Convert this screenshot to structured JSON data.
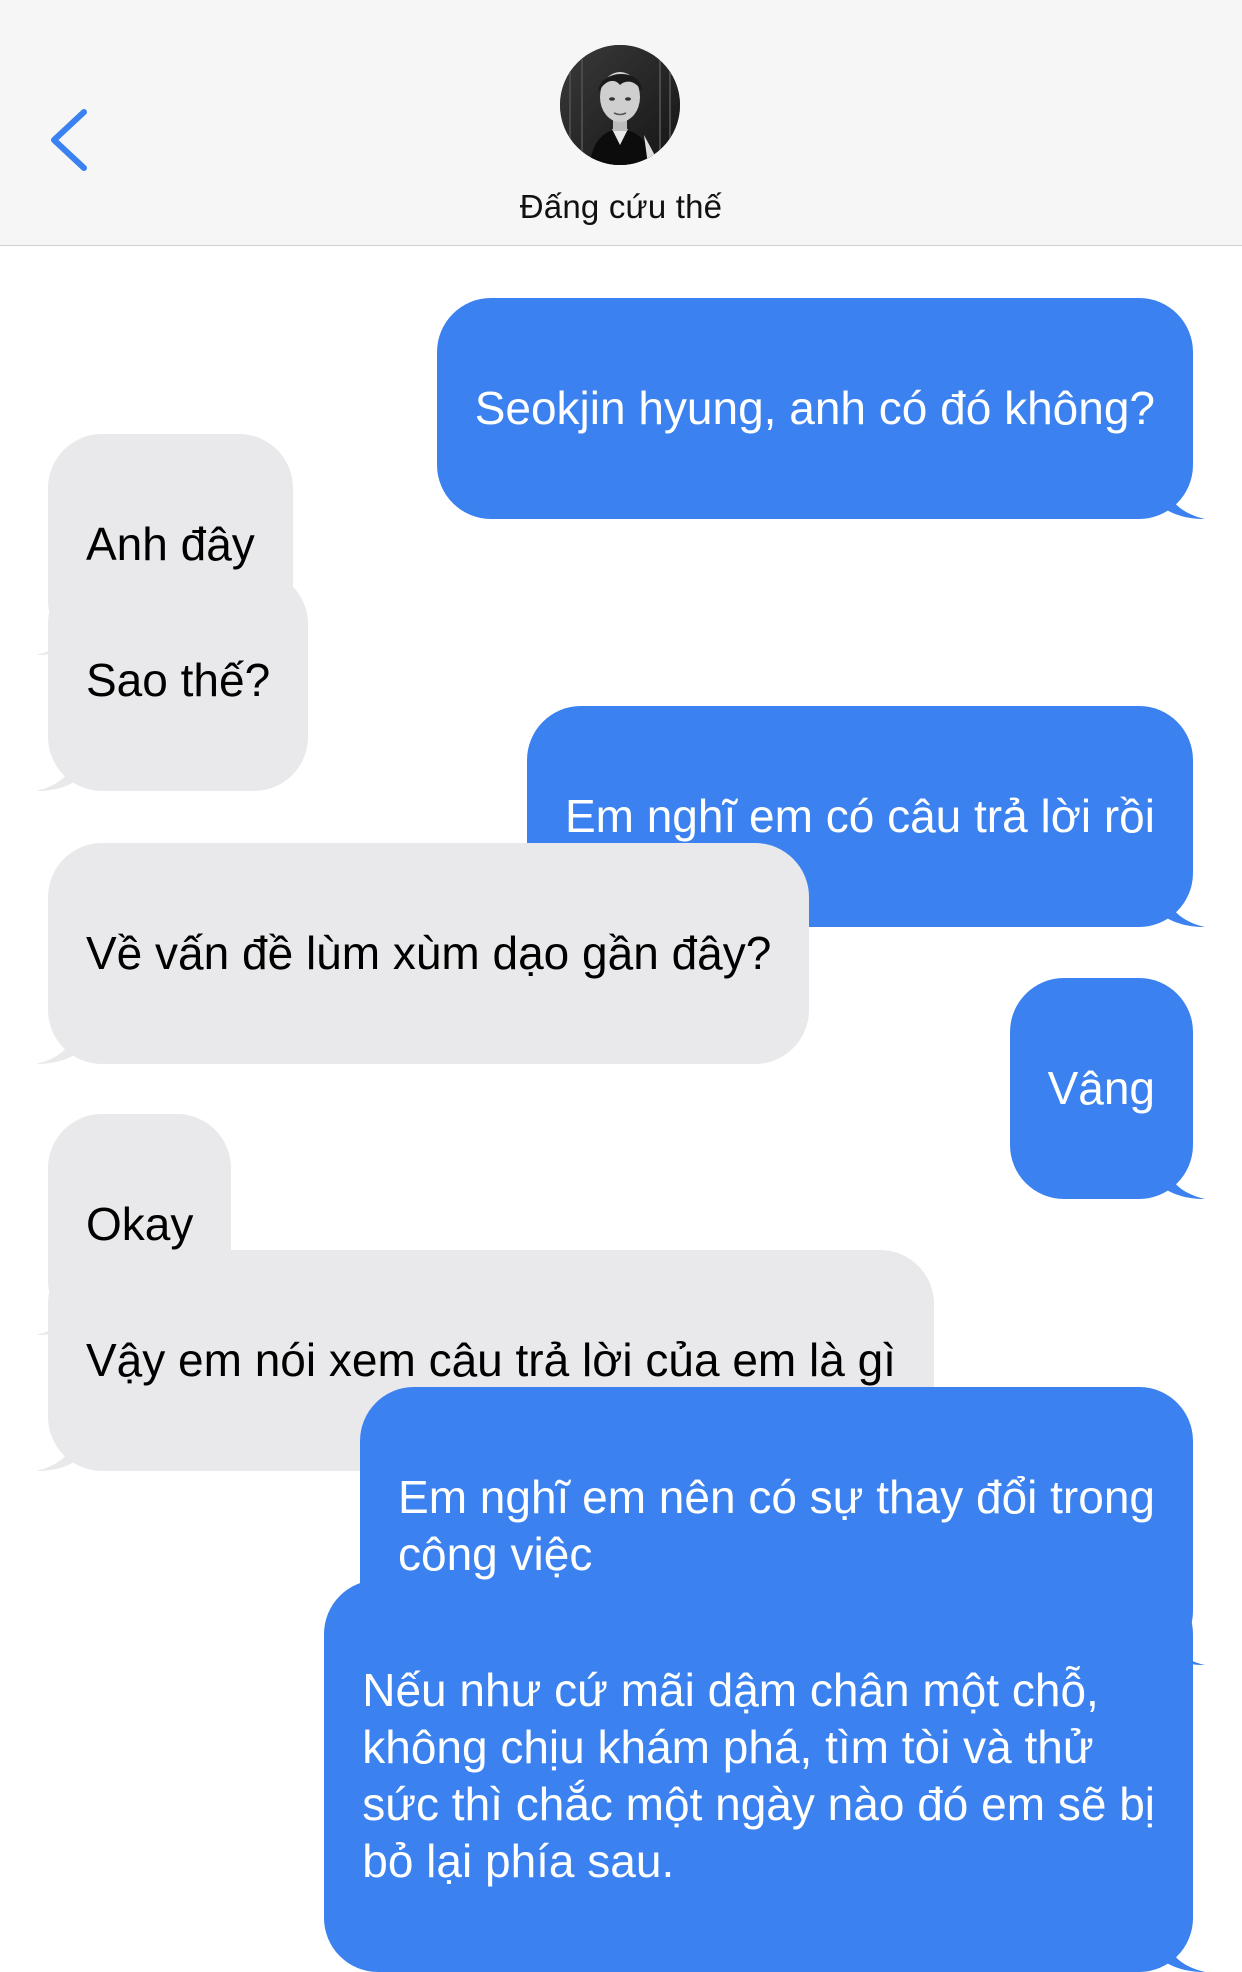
{
  "contact": {
    "name": "Đấng cứu thế"
  },
  "icons": {
    "back": "chevron-left-icon",
    "avatar": "avatar"
  },
  "colors": {
    "sent_bubble": "#3b82f0",
    "received_bubble": "#e9e9eb",
    "back_chevron": "#3b82f0",
    "header_bg": "#f6f6f6"
  },
  "messages": [
    {
      "side": "sent",
      "text": "Seokjin hyung, anh có đó không?"
    },
    {
      "side": "received",
      "text": "Anh đây"
    },
    {
      "side": "received",
      "text": "Sao thế?"
    },
    {
      "side": "sent",
      "text": "Em nghĩ em có câu trả lời rồi"
    },
    {
      "side": "received",
      "text": "Về vấn đề lùm xùm dạo gần đây?"
    },
    {
      "side": "sent",
      "text": "Vâng"
    },
    {
      "side": "received",
      "text": "Okay"
    },
    {
      "side": "received",
      "text": "Vậy em nói xem câu trả lời của em là gì"
    },
    {
      "side": "sent",
      "text": "Em nghĩ em nên có sự thay đổi trong\ncông việc"
    },
    {
      "side": "sent",
      "text": "Nếu như cứ mãi dậm chân một chỗ,\nkhông chịu khám phá, tìm tòi và thử\nsức thì chắc một ngày nào đó em sẽ bị\nbỏ lại phía sau."
    }
  ]
}
